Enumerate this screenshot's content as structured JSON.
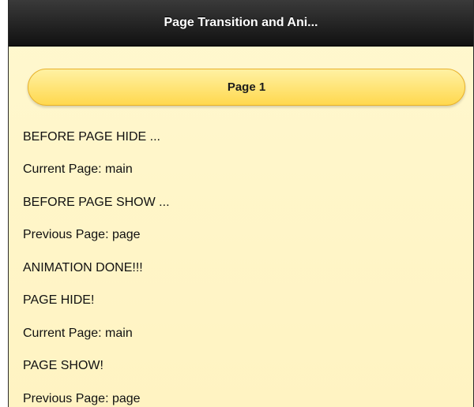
{
  "header": {
    "title": "Page Transition and Ani..."
  },
  "main": {
    "page_button_label": "Page 1",
    "log": [
      "BEFORE PAGE HIDE ...",
      "Current Page: main",
      "BEFORE PAGE SHOW ...",
      "Previous Page: page",
      "ANIMATION DONE!!!",
      "PAGE HIDE!",
      "Current Page: main",
      "PAGE SHOW!",
      "Previous Page: page"
    ]
  },
  "colors": {
    "header_bg": "#1f1f1f",
    "content_bg": "#fff6c8",
    "button_bg": "#ffdf6a",
    "button_border": "#e8b12a"
  }
}
